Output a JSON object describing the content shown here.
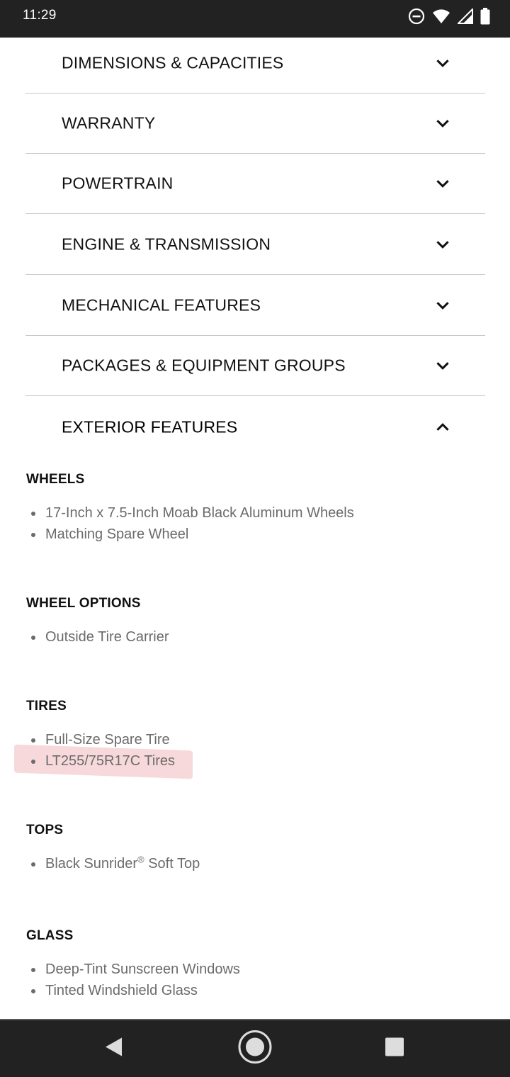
{
  "status_bar": {
    "time": "11:29",
    "icons": [
      "do-not-disturb-icon",
      "wifi-icon",
      "signal-icon",
      "battery-icon"
    ]
  },
  "accordion": {
    "items": [
      {
        "label": "DIMENSIONS & CAPACITIES",
        "expanded": false
      },
      {
        "label": "WARRANTY",
        "expanded": false
      },
      {
        "label": "POWERTRAIN",
        "expanded": false
      },
      {
        "label": "ENGINE & TRANSMISSION",
        "expanded": false
      },
      {
        "label": "MECHANICAL FEATURES",
        "expanded": false
      },
      {
        "label": "PACKAGES & EQUIPMENT GROUPS",
        "expanded": false
      },
      {
        "label": "EXTERIOR FEATURES",
        "expanded": true
      }
    ]
  },
  "exterior_features": {
    "sections": [
      {
        "title": "WHEELS",
        "items": [
          "17-Inch x 7.5-Inch Moab Black Aluminum Wheels",
          "Matching Spare Wheel"
        ]
      },
      {
        "title": "WHEEL OPTIONS",
        "items": [
          "Outside Tire Carrier"
        ]
      },
      {
        "title": "TIRES",
        "items": [
          "Full-Size Spare Tire",
          "LT255/75R17C Tires"
        ]
      },
      {
        "title": "TOPS",
        "items": [
          "Black Sunrider",
          "Soft Top"
        ]
      },
      {
        "title": "GLASS",
        "items": [
          "Deep-Tint Sunscreen Windows",
          "Tinted Windshield Glass"
        ]
      }
    ],
    "registered_mark": "®"
  },
  "colors": {
    "status_bar_bg": "#222222",
    "highlight": "#f0aaaf",
    "text_muted": "#6b6b6b"
  },
  "nav_bar": {
    "icons": [
      "back-icon",
      "home-icon",
      "recents-icon"
    ]
  }
}
